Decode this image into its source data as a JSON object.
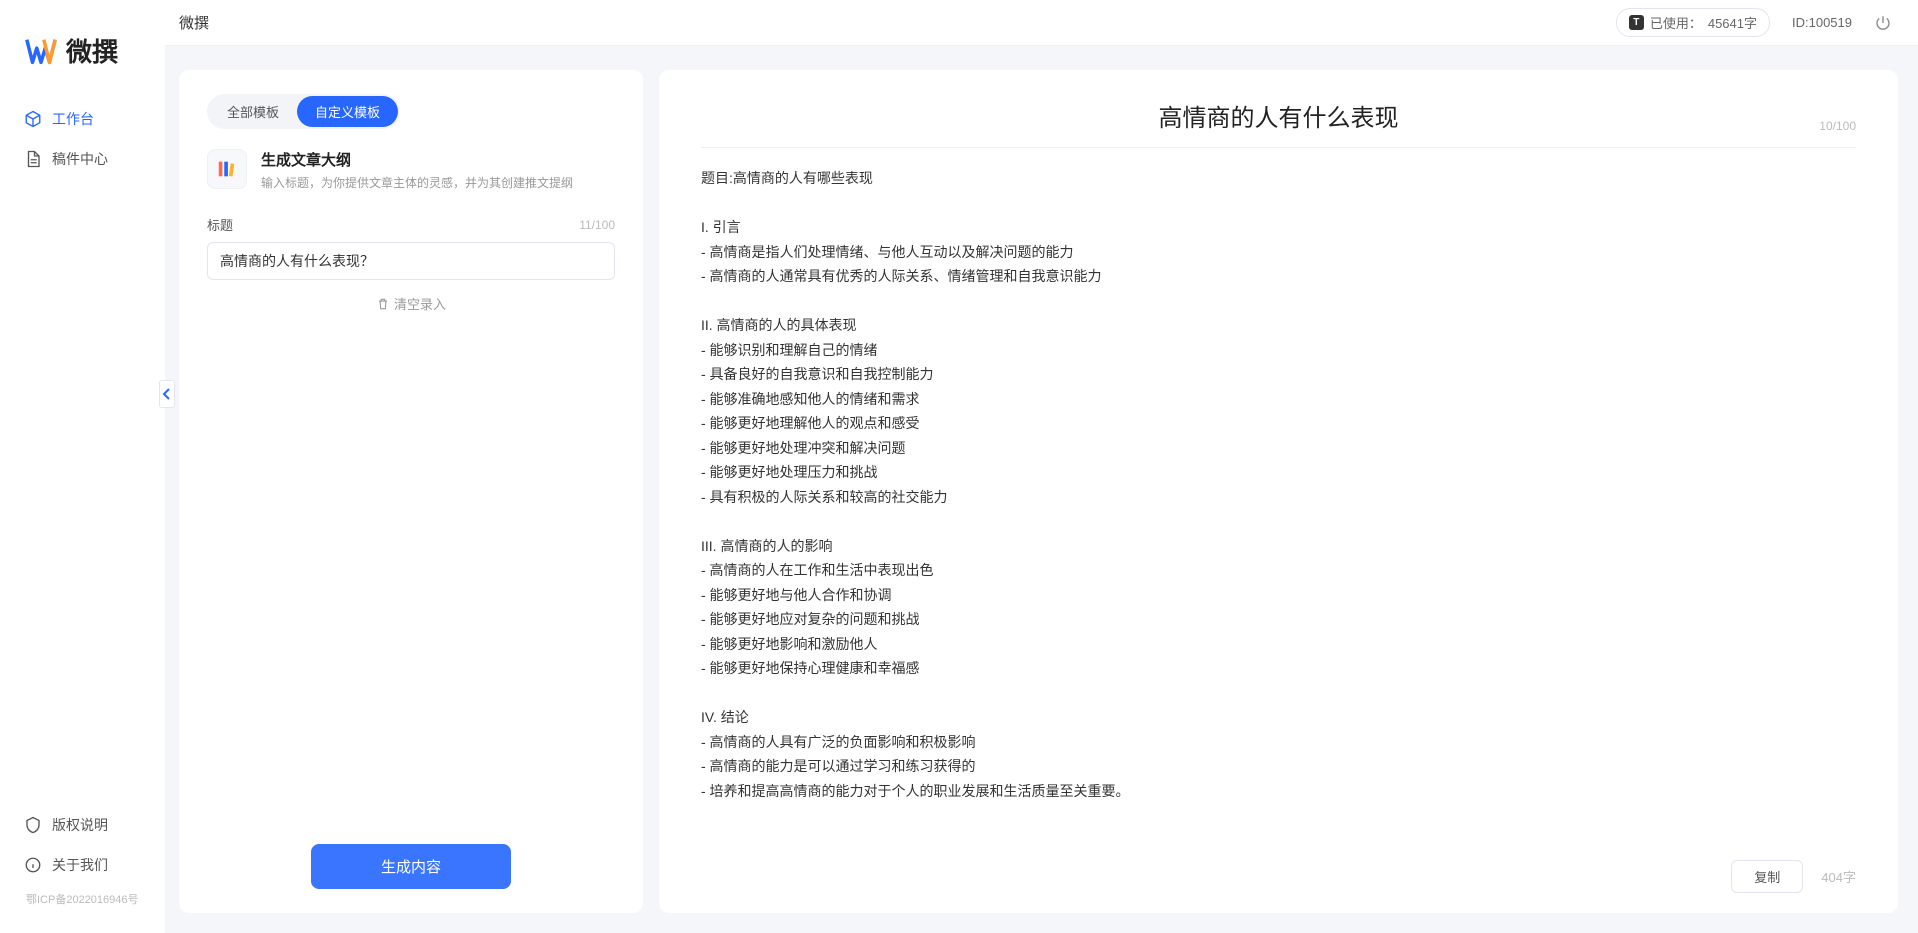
{
  "brand": {
    "name": "微撰"
  },
  "sidebar": {
    "nav": [
      {
        "label": "工作台"
      },
      {
        "label": "稿件中心"
      }
    ],
    "footer": [
      {
        "label": "版权说明"
      },
      {
        "label": "关于我们"
      }
    ],
    "icp": "鄂ICP备2022016946号"
  },
  "topbar": {
    "title": "微撰",
    "usage_prefix": "已使用：",
    "usage_value": "45641字",
    "id_label": "ID:100519"
  },
  "left": {
    "tabs": [
      {
        "label": "全部模板"
      },
      {
        "label": "自定义模板"
      }
    ],
    "template": {
      "title": "生成文章大纲",
      "desc": "输入标题，为你提供文章主体的灵感，并为其创建推文提纲"
    },
    "field_label": "标题",
    "char_counter": "11/100",
    "input_value": "高情商的人有什么表现？",
    "clear_label": "清空录入",
    "generate_label": "生成内容"
  },
  "right": {
    "title": "高情商的人有什么表现",
    "title_counter": "10/100",
    "body": "题目:高情商的人有哪些表现\n\nI. 引言\n- 高情商是指人们处理情绪、与他人互动以及解决问题的能力\n- 高情商的人通常具有优秀的人际关系、情绪管理和自我意识能力\n\nII. 高情商的人的具体表现\n- 能够识别和理解自己的情绪\n- 具备良好的自我意识和自我控制能力\n- 能够准确地感知他人的情绪和需求\n- 能够更好地理解他人的观点和感受\n- 能够更好地处理冲突和解决问题\n- 能够更好地处理压力和挑战\n- 具有积极的人际关系和较高的社交能力\n\nIII. 高情商的人的影响\n- 高情商的人在工作和生活中表现出色\n- 能够更好地与他人合作和协调\n- 能够更好地应对复杂的问题和挑战\n- 能够更好地影响和激励他人\n- 能够更好地保持心理健康和幸福感\n\nIV. 结论\n- 高情商的人具有广泛的负面影响和积极影响\n- 高情商的能力是可以通过学习和练习获得的\n- 培养和提高高情商的能力对于个人的职业发展和生活质量至关重要。",
    "copy_label": "复制",
    "word_count": "404字"
  }
}
